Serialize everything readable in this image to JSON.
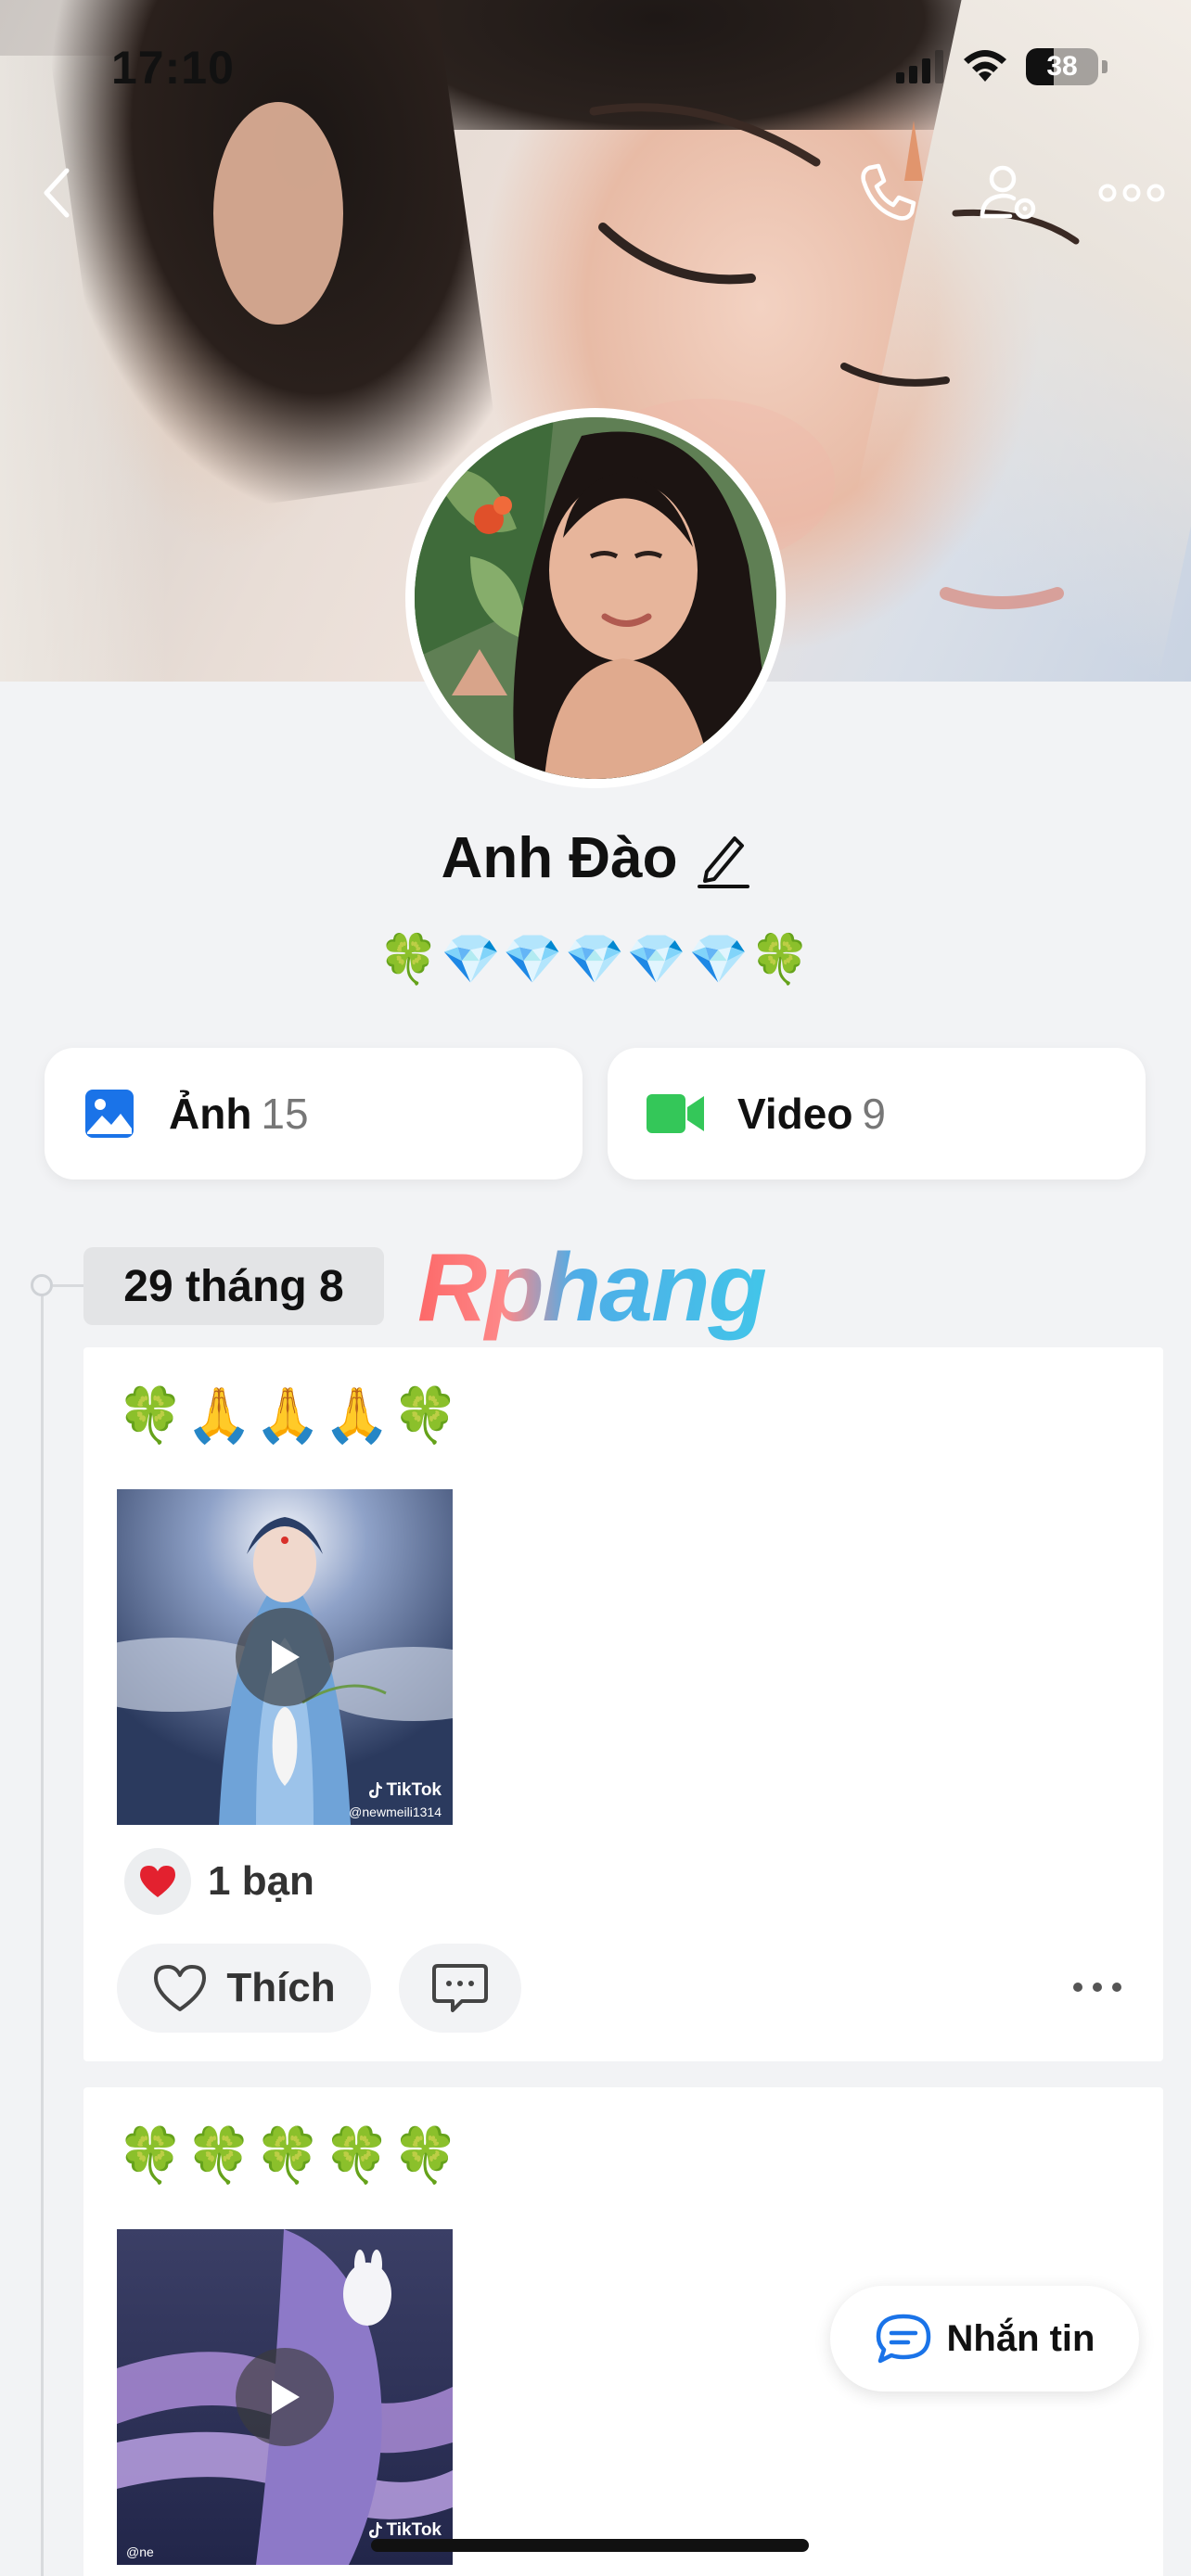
{
  "status_bar": {
    "time": "17:10",
    "battery_level": "38",
    "battery_fraction": 0.38
  },
  "nav": {
    "back_icon": "chevron-left-icon",
    "call_icon": "phone-icon",
    "user_settings_icon": "user-gear-icon",
    "more_icon": "ellipsis-icon"
  },
  "profile": {
    "name": "Anh Đào",
    "bio": "🍀💎💎💎💎💎🍀"
  },
  "media": {
    "photos": {
      "label": "Ảnh",
      "count": "15",
      "icon": "photo-icon",
      "color": "#1a73e8"
    },
    "videos": {
      "label": "Video",
      "count": "9",
      "icon": "video-camera-icon",
      "color": "#34c759"
    }
  },
  "timeline": {
    "date": "29 tháng 8",
    "watermark": "Rphang"
  },
  "posts": [
    {
      "caption": "🍀🙏🙏🙏🍀",
      "tiktok_label": "TikTok",
      "tiktok_handle": "@newmeili1314",
      "reaction_text": "1 bạn",
      "like_label": "Thích"
    },
    {
      "caption": "🍀🍀🍀🍀🍀",
      "tiktok_label": "TikTok",
      "tiktok_handle": "@ne"
    }
  ],
  "fab": {
    "message_label": "Nhắn tin",
    "accent": "#1a73e8"
  }
}
